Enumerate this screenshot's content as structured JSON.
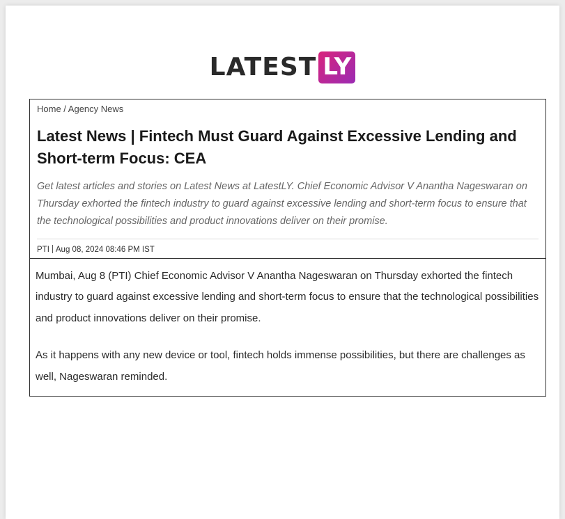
{
  "logo": {
    "text": "LATEST",
    "badge": "LY"
  },
  "breadcrumb": "Home / Agency News",
  "headline": "Latest News | Fintech Must Guard Against Excessive Lending and Short-term Focus: CEA",
  "summary": "Get latest articles and stories on Latest News at LatestLY. Chief Economic Advisor V Anantha Nageswaran on Thursday exhorted the fintech industry to guard against excessive lending and short-term focus to ensure that the technological possibilities and product innovations deliver on their promise.",
  "byline": {
    "source": "PTI",
    "date": "Aug 08, 2024 08:46 PM IST"
  },
  "body": [
    "Mumbai, Aug 8 (PTI) Chief Economic Advisor V Anantha Nageswaran on Thursday exhorted the fintech industry to guard against excessive lending and short-term focus to ensure that the technological possibilities and product innovations deliver on their promise.",
    "As it happens with any new device or tool, fintech holds immense possibilities, but there are challenges as well, Nageswaran reminded."
  ],
  "colors": {
    "brand_gradient_start": "#d8247c",
    "brand_gradient_end": "#9b2bb3"
  }
}
